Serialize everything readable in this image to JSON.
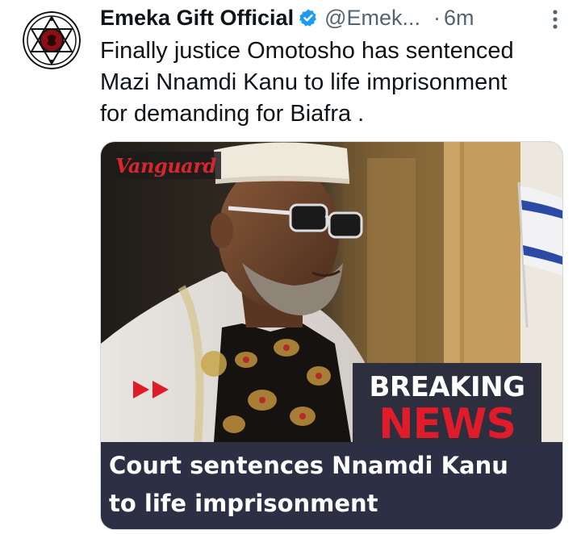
{
  "author": {
    "display_name": "Emeka Gift Official",
    "handle": "@Emek...",
    "separator": "·",
    "time": "6m",
    "avatar_icon": "hexagram-logo-icon"
  },
  "tweet": {
    "text": "Finally justice Omotosho has sentenced\nMazi Nnamdi Kanu to life imprisonment\nfor demanding for Biafra ."
  },
  "media": {
    "brand": "Vanguard",
    "breaking_label": "BREAKING",
    "news_label": "NEWS",
    "caption": "Court sentences Nnamdi Kanu\nto life imprisonment"
  },
  "colors": {
    "verified": "#1d9bf0",
    "brand": "#d8262f",
    "news": "#e11c2a",
    "caption_bg": "#2d2f45",
    "muted_text": "#536471"
  }
}
